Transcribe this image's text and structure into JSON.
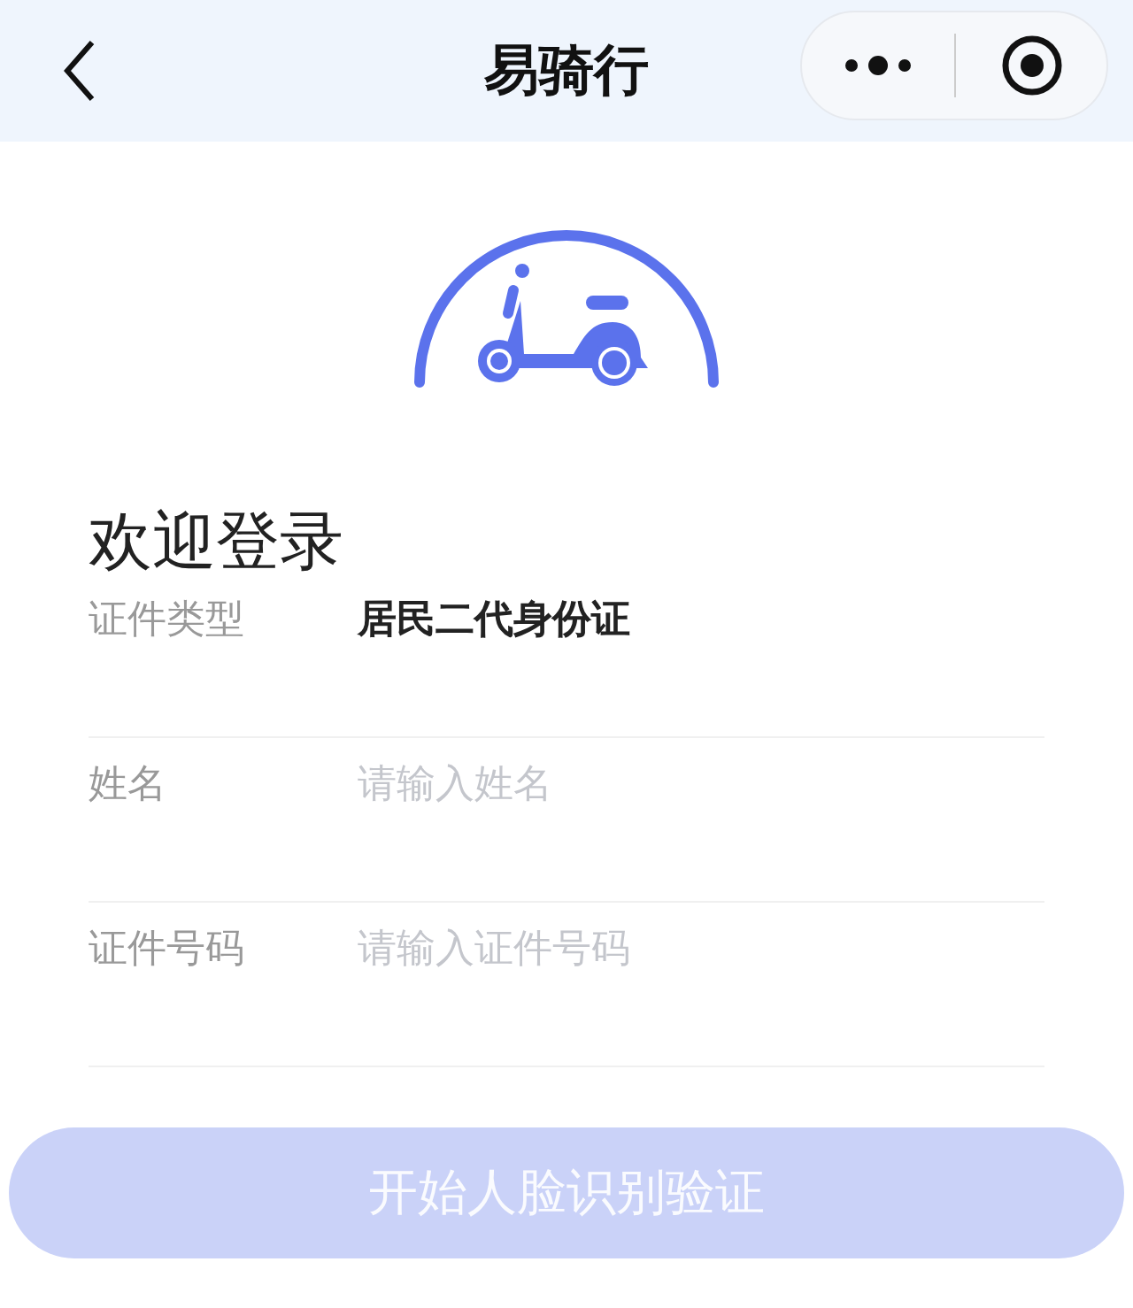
{
  "nav": {
    "title": "易骑行"
  },
  "heading": "欢迎登录",
  "fields": [
    {
      "kind": "value",
      "label": "证件类型",
      "value": "居民二代身份证"
    },
    {
      "kind": "input",
      "label": "姓名",
      "placeholder": "请输入姓名"
    },
    {
      "kind": "input",
      "label": "证件号码",
      "placeholder": "请输入证件号码"
    }
  ],
  "submit": {
    "label": "开始人脸识别验证",
    "disabled": true
  }
}
